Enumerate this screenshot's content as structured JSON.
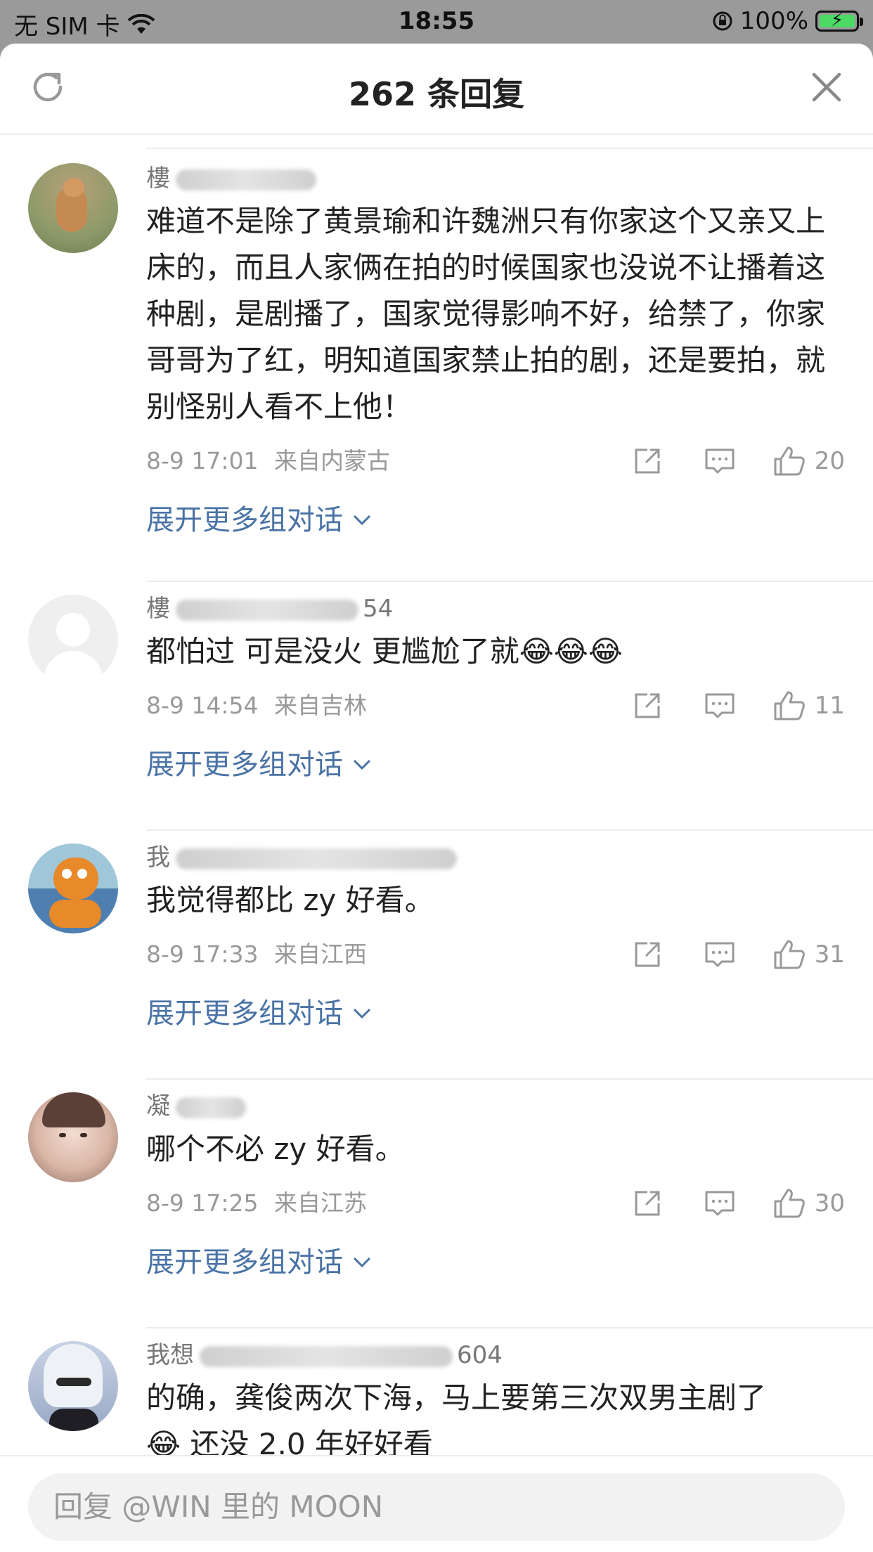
{
  "status_bar": {
    "carrier": "无 SIM 卡",
    "time": "18:55",
    "battery": "100%"
  },
  "header": {
    "title": "262 条回复"
  },
  "comments": [
    {
      "username": "樓",
      "text": "难道不是除了黄景瑜和许魏洲只有你家这个又亲又上床的，而且人家俩在拍的时候国家也没说不让播着这种剧，是剧播了，国家觉得影响不好，给禁了，你家哥哥为了红，明知道国家禁止拍的剧，还是要拍，就别怪别人看不上他！",
      "time": "8-9 17:01",
      "location": "来自内蒙古",
      "likes": "20",
      "expand": "展开更多组对话"
    },
    {
      "username": "樓",
      "username_suffix": "54",
      "text": "都怕过 可是没火 更尴尬了就😂😂😂",
      "time": "8-9 14:54",
      "location": "来自吉林",
      "likes": "11",
      "expand": "展开更多组对话"
    },
    {
      "username": "我",
      "text": "我觉得都比 zy 好看。",
      "time": "8-9 17:33",
      "location": "来自江西",
      "likes": "31",
      "expand": "展开更多组对话"
    },
    {
      "username": "凝",
      "text": "哪个不必 zy 好看。",
      "time": "8-9 17:25",
      "location": "来自江苏",
      "likes": "30",
      "expand": "展开更多组对话"
    },
    {
      "username": "我想",
      "username_suffix": "604",
      "text": "的确，龚俊两次下海，马上要第三次双男主剧了",
      "text_cut": "😂 还没 2.0 年好好看"
    }
  ],
  "reply_bar": {
    "placeholder": "回复 @WIN 里的 MOON"
  },
  "colors": {
    "link": "#4a73a6",
    "meta": "#999999",
    "battery_fill": "#4cd964"
  }
}
